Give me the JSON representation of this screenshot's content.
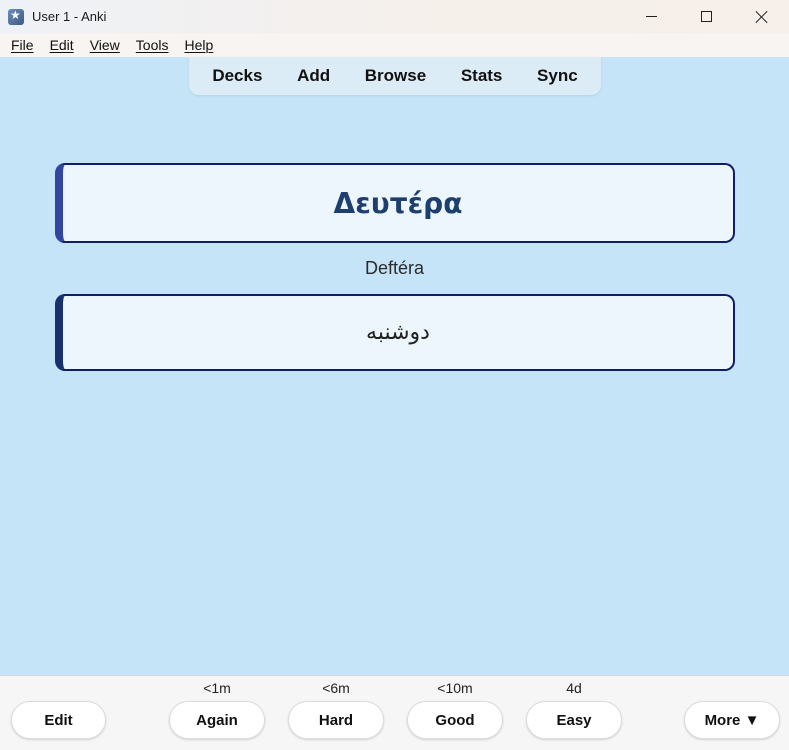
{
  "window": {
    "title": "User 1 - Anki"
  },
  "menu": [
    "File",
    "Edit",
    "View",
    "Tools",
    "Help"
  ],
  "nav": [
    "Decks",
    "Add",
    "Browse",
    "Stats",
    "Sync"
  ],
  "card": {
    "front": "Δευτέρα",
    "transliteration": "Deftéra",
    "back": "دوشنبه"
  },
  "bottom": {
    "edit": "Edit",
    "more": "More ▼",
    "answers": [
      {
        "interval": "<1m",
        "label": "Again"
      },
      {
        "interval": "<6m",
        "label": "Hard"
      },
      {
        "interval": "<10m",
        "label": "Good"
      },
      {
        "interval": "4d",
        "label": "Easy"
      }
    ]
  },
  "colors": {
    "background": "#c5e4f7",
    "card_border": "#0f1d6b",
    "front_text": "#1d3f6d"
  }
}
